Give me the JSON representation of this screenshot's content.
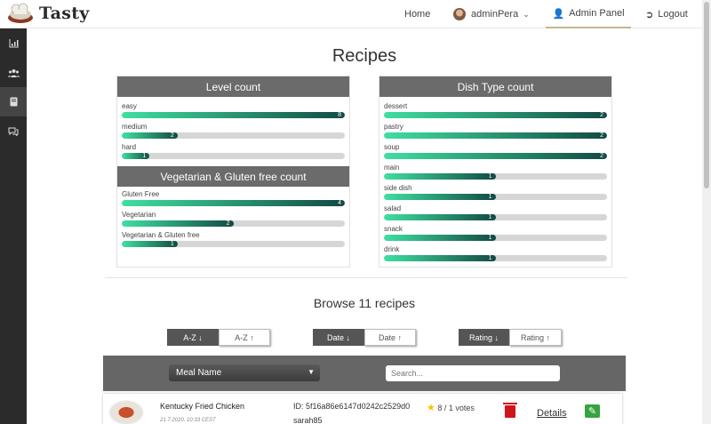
{
  "brand": {
    "name": "Tasty"
  },
  "nav": {
    "home": "Home",
    "user": "adminPera",
    "admin": "Admin Panel",
    "logout": "Logout"
  },
  "sidebar": {
    "items": [
      {
        "icon": "bar-chart-icon"
      },
      {
        "icon": "users-icon"
      },
      {
        "icon": "book-icon"
      },
      {
        "icon": "comments-icon"
      }
    ]
  },
  "page_title": "Recipes",
  "charts": {
    "level": {
      "title": "Level count",
      "max": 8,
      "items": [
        {
          "label": "easy",
          "value": 8
        },
        {
          "label": "medium",
          "value": 2
        },
        {
          "label": "hard",
          "value": 1
        }
      ]
    },
    "veg": {
      "title": "Vegetarian & Gluten free count",
      "max": 4,
      "items": [
        {
          "label": "Gluten Free",
          "value": 4
        },
        {
          "label": "Vegetarian",
          "value": 2
        },
        {
          "label": "Vegetarian & Gluten free",
          "value": 1
        }
      ]
    },
    "dish": {
      "title": "Dish Type count",
      "max": 2,
      "items": [
        {
          "label": "dessert",
          "value": 2
        },
        {
          "label": "pastry",
          "value": 2
        },
        {
          "label": "soup",
          "value": 2
        },
        {
          "label": "main",
          "value": 1
        },
        {
          "label": "side dish",
          "value": 1
        },
        {
          "label": "salad",
          "value": 1
        },
        {
          "label": "snack",
          "value": 1
        },
        {
          "label": "drink",
          "value": 1
        }
      ]
    }
  },
  "browse": {
    "title": "Browse 11 recipes",
    "sort": {
      "az_desc": "A-Z ↓",
      "az_asc": "A-Z ↑",
      "date_desc": "Date ↓",
      "date_asc": "Date ↑",
      "rating_desc": "Rating ↓",
      "rating_asc": "Rating ↑"
    },
    "filter": {
      "field": "Meal Name",
      "search_placeholder": "Search..."
    }
  },
  "recipe": {
    "name": "Kentucky Fried Chicken",
    "date": "21.7.2020. 10:33 CEST",
    "id": "ID: 5f16a86e6147d0242c2529d0",
    "author": "sarah85",
    "rating": "8 / 1 votes",
    "details": "Details"
  },
  "colors": {
    "bar_start": "#3ee0a0",
    "bar_end": "#134a44",
    "panel_head": "#6b6b6b",
    "sidebar": "#2b2b2b"
  }
}
